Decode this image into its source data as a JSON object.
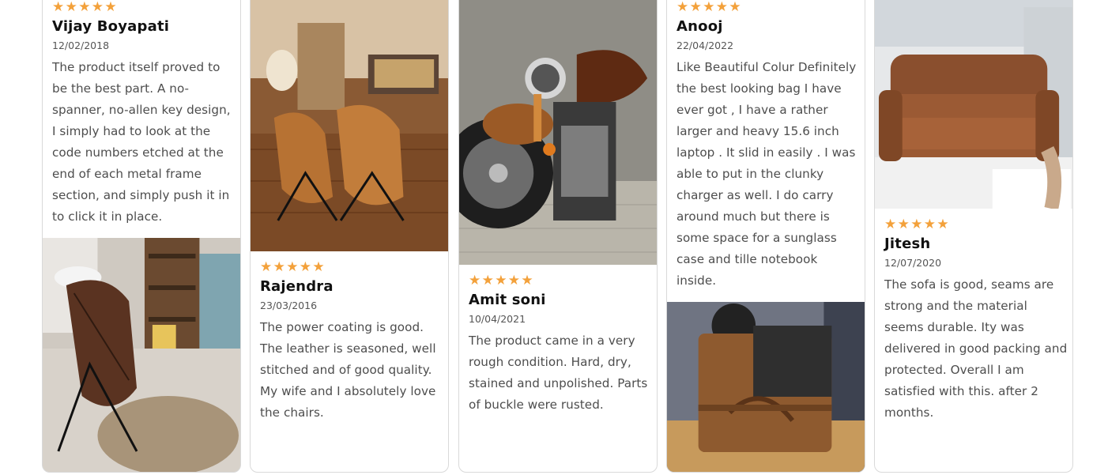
{
  "rating_star": "★",
  "reviews": [
    {
      "name": "Vijay Boyapati",
      "date": "12/02/2018",
      "rating": 5,
      "text": "The product itself proved to be the best part. A no-spanner, no-allen key design, I simply had to look at the code numbers etched at the end of each metal frame section, and simply push it in to click it in place.",
      "photo": "butterfly-chair-bathroom-photo"
    },
    {
      "name": "Rajendra",
      "date": "23/03/2016",
      "rating": 5,
      "text": "The power coating is good. The leather is seasoned, well stitched and of good quality. My wife and I absolutely love the chairs.",
      "photo": "butterfly-chairs-living-room-photo"
    },
    {
      "name": "Amit soni",
      "date": "10/04/2021",
      "rating": 5,
      "text": "The product came in a very rough condition. Hard, dry, stained and unpolished. Parts of buckle were rusted.",
      "photo": "motorcycle-tool-roll-photo"
    },
    {
      "name": "Anooj",
      "date": "22/04/2022",
      "rating": 5,
      "text": "Like Beautiful Colur Definitely the best looking bag I have ever got , I have a rather larger and heavy 15.6 inch laptop . It slid in easily . I was able to put in the clunky charger as well. I do carry around much but there is some space for a sunglass case and tille notebook inside.",
      "photo": "leather-messenger-bag-photo"
    },
    {
      "name": "Jitesh",
      "date": "12/07/2020",
      "rating": 5,
      "text": "The sofa is good, seams are strong and the material seems durable. Ity was delivered in good packing and protected. Overall I am satisfied with this. after 2 months.",
      "photo": "leather-sofa-photo"
    }
  ],
  "colors": {
    "star": "#f3a13b",
    "card_border": "#d9d9d9",
    "name": "#111111",
    "text": "#4d4d4d"
  }
}
